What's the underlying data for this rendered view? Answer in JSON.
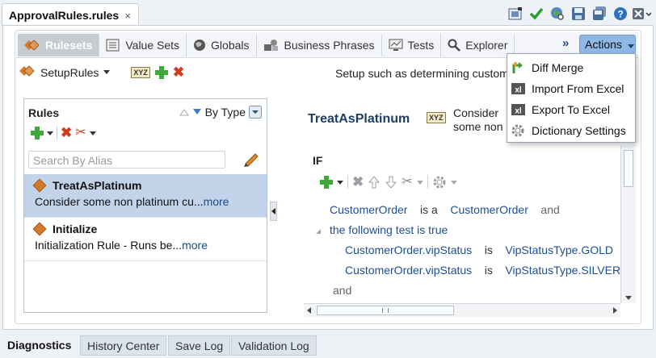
{
  "doc_tab": {
    "title": "ApprovalRules.rules",
    "close": "×"
  },
  "top_icons": [
    "validate-icon",
    "checkmark-icon",
    "globe-search-icon",
    "save-icon",
    "save-all-icon",
    "help-icon",
    "close-window-icon"
  ],
  "nav": {
    "tabs": [
      {
        "label": "Rulesets",
        "icon": "rulesets-icon"
      },
      {
        "label": "Value Sets",
        "icon": "value-sets-icon"
      },
      {
        "label": "Globals",
        "icon": "globe-icon"
      },
      {
        "label": "Business Phrases",
        "icon": "business-phrases-icon"
      },
      {
        "label": "Tests",
        "icon": "tests-icon"
      },
      {
        "label": "Explorer",
        "icon": "search-icon"
      }
    ],
    "more": "»",
    "actions_label": "Actions"
  },
  "ruleset": {
    "name": "SetupRules",
    "description": "Setup such as determining custom"
  },
  "actions_menu": {
    "items": [
      {
        "label": "Diff Merge",
        "icon": "diff-merge-icon"
      },
      {
        "label": "Import From Excel",
        "icon": "excel-import-icon"
      },
      {
        "label": "Export To Excel",
        "icon": "excel-export-icon"
      },
      {
        "label": "Dictionary Settings",
        "icon": "gear-icon"
      }
    ]
  },
  "rules_panel": {
    "title": "Rules",
    "sort_label": "By Type",
    "search_placeholder": "Search By Alias",
    "rules": [
      {
        "name": "TreatAsPlatinum",
        "desc": "Consider some non platinum cu...",
        "more": "more",
        "selected": true
      },
      {
        "name": "Initialize",
        "desc": "Initialization Rule - Runs be...",
        "more": "more",
        "selected": false
      }
    ]
  },
  "detail": {
    "title": "TreatAsPlatinum",
    "desc": "Consider some non platinum customers",
    "if_label": "IF",
    "line1": {
      "lhs": "CustomerOrder",
      "op": "is a",
      "rhs": "CustomerOrder",
      "conj": "and"
    },
    "line2": {
      "text": "the following test is true"
    },
    "line3": {
      "lhs": "CustomerOrder.vipStatus",
      "op": "is",
      "rhs": "VipStatusType.GOLD"
    },
    "line4": {
      "lhs": "CustomerOrder.vipStatus",
      "op": "is",
      "rhs": "VipStatusType.SILVER"
    },
    "line5": {
      "text": "and"
    }
  },
  "bottom_tabs": [
    "Diagnostics",
    "History Center",
    "Save Log",
    "Validation Log"
  ]
}
